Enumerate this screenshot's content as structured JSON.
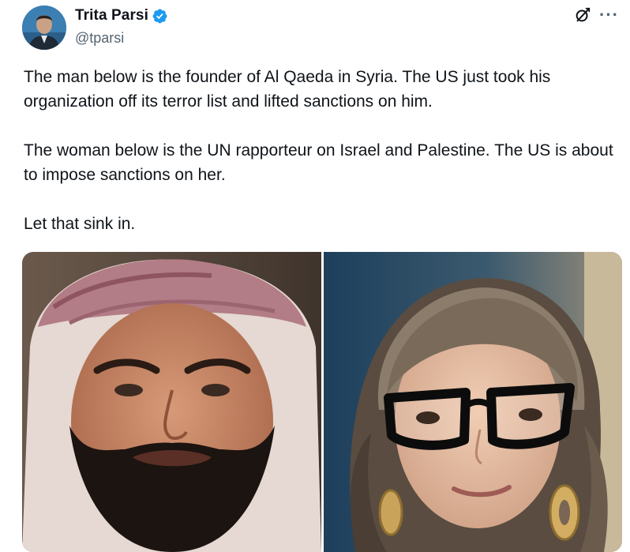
{
  "author": {
    "display_name": "Trita Parsi",
    "handle": "@tparsi",
    "verified": true,
    "avatar_icon": "profile-photo"
  },
  "actions": {
    "grok_icon": "grok-icon",
    "more_icon": "more-options-icon",
    "more_label": "···"
  },
  "tweet": {
    "paragraphs": [
      "The man below is the founder of Al Qaeda in Syria. The US just took his organization off its terror list and lifted sanctions on him.",
      "The woman below is the UN rapporteur on Israel and Palestine. The US is about to impose sanctions on her.",
      "Let that sink in."
    ]
  },
  "media": {
    "images": [
      "man-in-headscarf-photo",
      "woman-with-glasses-photo"
    ]
  },
  "colors": {
    "text": "#0f1419",
    "secondary_text": "#536471",
    "verified_blue": "#1d9bf0"
  }
}
